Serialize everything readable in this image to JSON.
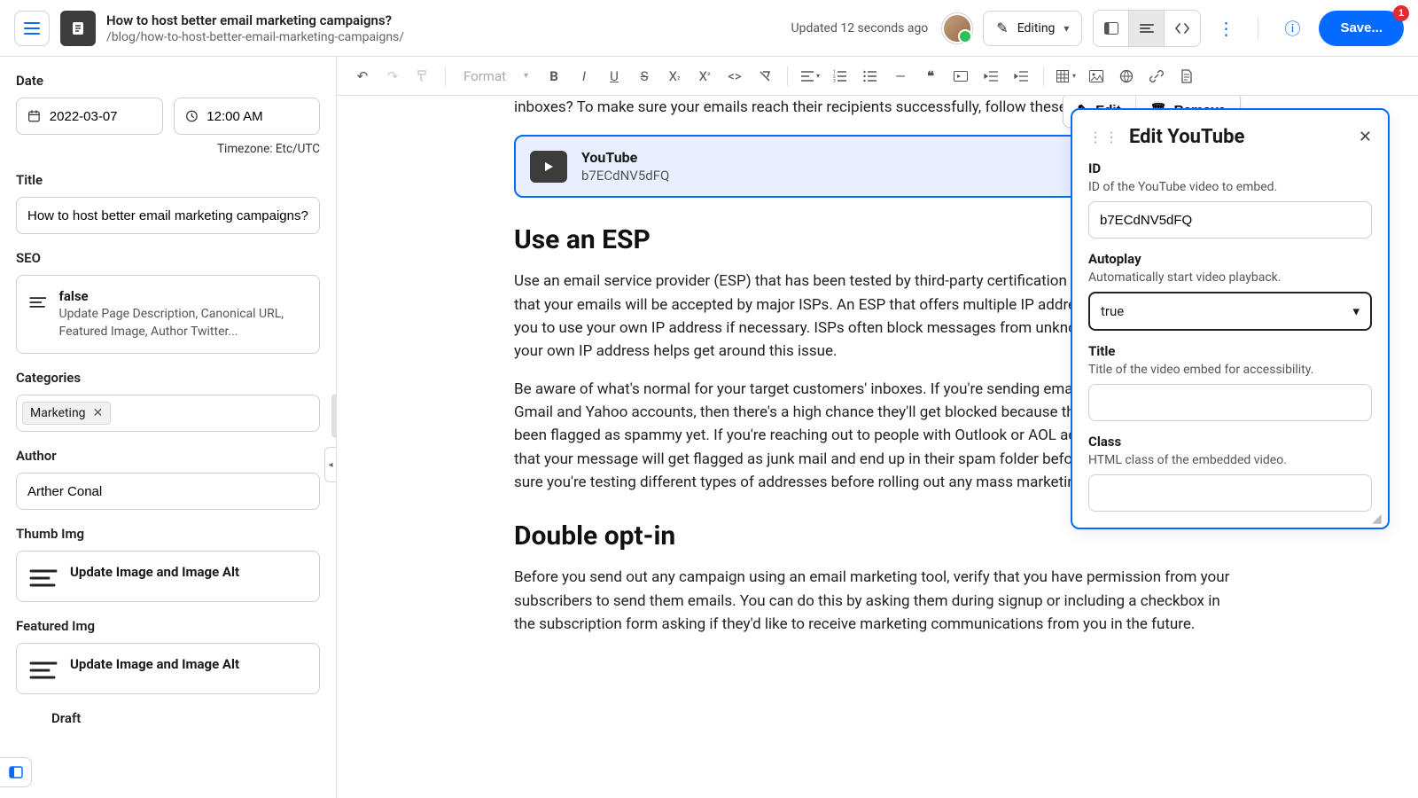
{
  "header": {
    "doc_title": "How to host better email marketing campaigns?",
    "doc_slug": "/blog/how-to-host-better-email-marketing-campaigns/",
    "updated": "Updated 12 seconds ago",
    "mode_label": "Editing",
    "save_label": "Save...",
    "save_badge": "1"
  },
  "sidebar": {
    "date_label": "Date",
    "date_value": "2022-03-07",
    "time_value": "12:00 AM",
    "timezone": "Timezone: Etc/UTC",
    "title_label": "Title",
    "title_value": "How to host better email marketing campaigns?",
    "seo_label": "SEO",
    "seo_card_title": "false",
    "seo_card_desc": "Update Page Description, Canonical URL, Featured Image, Author Twitter...",
    "categories_label": "Categories",
    "category_chip": "Marketing",
    "author_label": "Author",
    "author_value": "Arther Conal",
    "thumb_label": "Thumb Img",
    "thumb_card": "Update Image and Image Alt",
    "featured_label": "Featured Img",
    "featured_card": "Update Image and Image Alt",
    "draft_label": "Draft"
  },
  "toolbar": {
    "format_label": "Format"
  },
  "content": {
    "intro_frag": "inboxes? To make sure your emails reach their recipients successfully, follow these email delivery tips.",
    "yt_label": "YouTube",
    "yt_id": "b7ECdNV5dFQ",
    "edit_btn": "Edit",
    "remove_btn": "Remove",
    "h_esp": "Use an ESP",
    "p_esp1": "Use an email service provider (ESP) that has been tested by third-party certification services. This ensures that your emails will be accepted by major ISPs. An ESP that offers multiple IP addresses, or one that allows you to use your own IP address if necessary. ISPs often block messages from unknown senders, so using your own IP address helps get around this issue.",
    "p_esp2": "Be aware of what's normal for your target customers' inboxes. If you're sending emails to people who are on Gmail and Yahoo accounts, then there's a high chance they'll get blocked because their addresses haven't been flagged as spammy yet. If you're reaching out to people with Outlook or AOL addresses, it's more likely that your message will get flagged as junk mail and end up in their spam folder before they ever see it. Make sure you're testing different types of addresses before rolling out any mass marketing campaigns.",
    "h_opt": "Double opt-in",
    "p_opt": "Before you send out any campaign using an email marketing tool, verify that you have permission from your subscribers to send them emails. You can do this by asking them during signup or including a checkbox in the subscription form asking if they'd like to receive marketing communications from you in the future."
  },
  "panel": {
    "title": "Edit YouTube",
    "id_label": "ID",
    "id_help": "ID of the YouTube video to embed.",
    "id_value": "b7ECdNV5dFQ",
    "autoplay_label": "Autoplay",
    "autoplay_help": "Automatically start video playback.",
    "autoplay_value": "true",
    "title_label": "Title",
    "title_help": "Title of the video embed for accessibility.",
    "title_value": "",
    "class_label": "Class",
    "class_help": "HTML class of the embedded video.",
    "class_value": ""
  }
}
